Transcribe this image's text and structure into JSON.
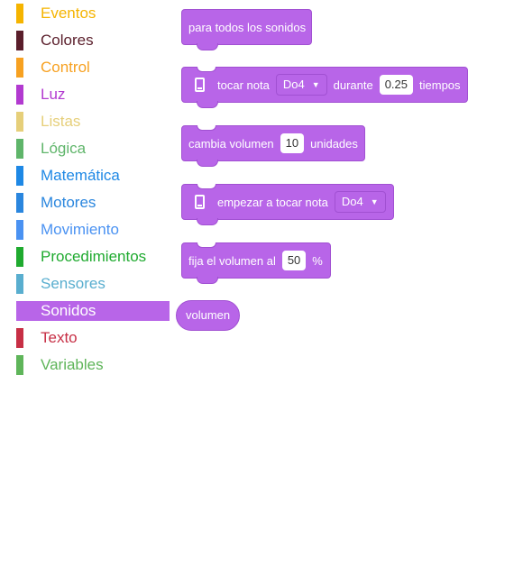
{
  "categories": [
    {
      "label": "Eventos",
      "color": "#f5b400"
    },
    {
      "label": "Colores",
      "color": "#5a1e2b"
    },
    {
      "label": "Control",
      "color": "#f7a121"
    },
    {
      "label": "Luz",
      "color": "#b23ad0"
    },
    {
      "label": "Listas",
      "color": "#e6cf7a"
    },
    {
      "label": "Lógica",
      "color": "#5fb56a"
    },
    {
      "label": "Matemática",
      "color": "#1e88e5"
    },
    {
      "label": "Motores",
      "color": "#2a86de"
    },
    {
      "label": "Movimiento",
      "color": "#4a92f2"
    },
    {
      "label": "Procedimientos",
      "color": "#1faa2f"
    },
    {
      "label": "Sensores",
      "color": "#59aecf"
    },
    {
      "label": "Sonidos",
      "color": "#b865e8",
      "selected": true
    },
    {
      "label": "Texto",
      "color": "#c72f45"
    },
    {
      "label": "Variables",
      "color": "#5fb55a"
    }
  ],
  "blocks": {
    "stop_all": {
      "text": "para todos los sonidos"
    },
    "play_note": {
      "icon": "device-icon",
      "text1": "tocar nota",
      "note": "Do4",
      "text2": "durante",
      "duration": "0.25",
      "text3": "tiempos"
    },
    "change_volume": {
      "text1": "cambia volumen",
      "value": "10",
      "text2": "unidades"
    },
    "start_note": {
      "icon": "device-icon",
      "text": "empezar a tocar nota",
      "note": "Do4"
    },
    "set_volume": {
      "text1": "fija el volumen al",
      "value": "50",
      "text2": "%"
    },
    "volume_reporter": {
      "text": "volumen"
    }
  },
  "colors": {
    "block": "#b865e8",
    "block_border": "#a150d2"
  }
}
